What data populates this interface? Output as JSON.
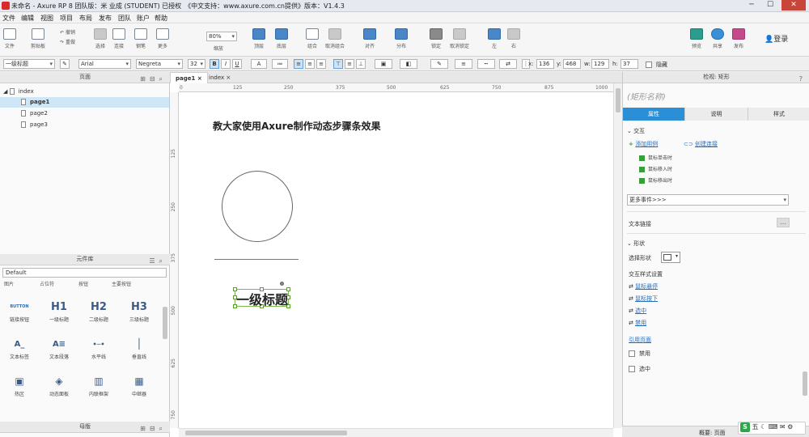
{
  "window": {
    "title": "未命名 - Axure RP 8 团队版：米 业成 (STUDENT) 已授权　《中文支持：www.axure.com.cn提供》版本：V1.4.3",
    "min": "─",
    "max": "☐",
    "close": "✕"
  },
  "menu": [
    "文件",
    "编辑",
    "视图",
    "项目",
    "布局",
    "发布",
    "团队",
    "账户",
    "帮助"
  ],
  "toolbar": {
    "file": "文件",
    "clipboard": "剪贴板",
    "undo": "撤销",
    "redo": "重做",
    "select": "选择",
    "connect": "连接",
    "pen": "钢笔",
    "more": "更多",
    "zoom_value": "80%",
    "zoom_label": "缩放",
    "top": "顶层",
    "bottom": "底层",
    "group": "组合",
    "ungroup": "取消组合",
    "align": "对齐",
    "distribute": "分布",
    "lock": "锁定",
    "unlock": "取消锁定",
    "left": "左",
    "right": "右",
    "preview": "预览",
    "share": "共享",
    "publish": "发布",
    "login": "登录"
  },
  "format": {
    "style": "一级标题",
    "font": "Arial",
    "weight": "Negreta",
    "size": "32",
    "bold": "B",
    "italic": "I",
    "underline": "U",
    "fontcolor": "A",
    "x_label": "x:",
    "x": "136",
    "y_label": "y:",
    "y": "468",
    "w_label": "w:",
    "w": "129",
    "h_label": "h:",
    "h": "37",
    "hidden": "隐藏"
  },
  "pages": {
    "title": "页面",
    "items": [
      {
        "label": "index"
      },
      {
        "label": "page1"
      },
      {
        "label": "page2"
      },
      {
        "label": "page3"
      }
    ]
  },
  "library": {
    "title": "元件库",
    "selected": "Default",
    "row0": [
      "图片",
      "占位符",
      "按钮",
      "主要按钮"
    ],
    "items": [
      {
        "glyph": "BUTTON",
        "label": "链接按钮"
      },
      {
        "glyph": "H1",
        "label": "一级标题"
      },
      {
        "glyph": "H2",
        "label": "二级标题"
      },
      {
        "glyph": "H3",
        "label": "三级标题"
      },
      {
        "glyph": "A_",
        "label": "文本标签"
      },
      {
        "glyph": "A≡",
        "label": "文本段落"
      },
      {
        "glyph": "•─•",
        "label": "水平线"
      },
      {
        "glyph": "│",
        "label": "垂直线"
      },
      {
        "glyph": "▣",
        "label": "热区"
      },
      {
        "glyph": "◈",
        "label": "动态面板"
      },
      {
        "glyph": "▥",
        "label": "内联框架"
      },
      {
        "glyph": "▦",
        "label": "中继器"
      }
    ]
  },
  "masters": {
    "title": "母版"
  },
  "canvas": {
    "tabs": [
      "page1",
      "index"
    ],
    "h_ticks": [
      "0",
      "125",
      "250",
      "375",
      "500",
      "625",
      "750",
      "875",
      "1000"
    ],
    "v_ticks": [
      "125",
      "250",
      "375",
      "500",
      "625",
      "750"
    ],
    "heading": "教大家使用Axure制作动态步骤条效果",
    "h1_text": "一级标题"
  },
  "inspector": {
    "header": "检视: 矩形",
    "name_placeholder": "(矩形名称)",
    "tabs": [
      "属性",
      "说明",
      "样式"
    ],
    "interaction": "交互",
    "add_case": "添加用例",
    "create_link": "创建连接",
    "events": [
      "鼠标单击时",
      "鼠标移入时",
      "鼠标移出时"
    ],
    "more_events": "更多事件>>>",
    "text_link": "文本链接",
    "shape": "形状",
    "select_shape": "选择形状",
    "interaction_style": "交互样式设置",
    "styles": [
      "鼠标悬停",
      "鼠标按下",
      "选中",
      "禁用"
    ],
    "ref_page": "引用页面",
    "disabled": "禁用",
    "selected": "选中",
    "status_left": "概要: 页面"
  },
  "ime": {
    "label": "五"
  },
  "colors": {
    "accent": "#2a8fd6",
    "selection": "#7bb84a"
  }
}
